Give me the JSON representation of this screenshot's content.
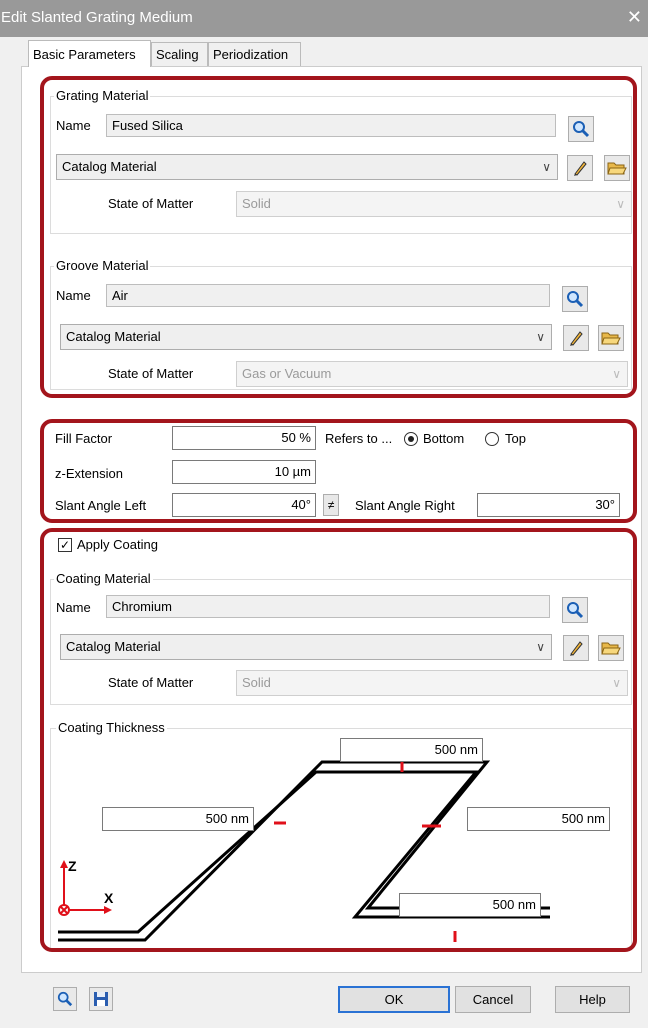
{
  "window": {
    "title": "Edit Slanted Grating Medium",
    "close_glyph": "✕"
  },
  "tabs": [
    {
      "label": "Basic Parameters",
      "active": true
    },
    {
      "label": "Scaling",
      "active": false
    },
    {
      "label": "Periodization",
      "active": false
    }
  ],
  "grating_material": {
    "legend": "Grating Material",
    "name_label": "Name",
    "name_value": "Fused Silica",
    "catalog": "Catalog Material",
    "state_label": "State of Matter",
    "state_value": "Solid"
  },
  "groove_material": {
    "legend": "Groove Material",
    "name_label": "Name",
    "name_value": "Air",
    "catalog": "Catalog Material",
    "state_label": "State of Matter",
    "state_value": "Gas or Vacuum"
  },
  "geometry": {
    "fill_factor_label": "Fill Factor",
    "fill_factor_value": "50 %",
    "refers_to_label": "Refers to ...",
    "option_bottom": "Bottom",
    "option_top": "Top",
    "selected": "Bottom",
    "z_extension_label": "z-Extension",
    "z_extension_value": "10 µm",
    "slant_left_label": "Slant Angle Left",
    "slant_left_value": "40°",
    "neq_button": "≠",
    "slant_right_label": "Slant Angle Right",
    "slant_right_value": "30°"
  },
  "coating": {
    "apply_label": "Apply Coating",
    "apply_checked": true,
    "check_glyph": "✓",
    "legend": "Coating Material",
    "name_label": "Name",
    "name_value": "Chromium",
    "catalog": "Catalog Material",
    "state_label": "State of Matter",
    "state_value": "Solid",
    "thickness_legend": "Coating Thickness",
    "thickness_top": "500 nm",
    "thickness_left": "500 nm",
    "thickness_right": "500 nm",
    "thickness_bottom": "500 nm",
    "axis_z": "Z",
    "axis_x": "X"
  },
  "footer": {
    "ok": "OK",
    "cancel": "Cancel",
    "help": "Help"
  },
  "colors": {
    "highlight_border": "#a3151c",
    "marker": "#e0101a",
    "default_button_border": "#2a72d4"
  },
  "icons": [
    "search-icon",
    "pencil-icon",
    "folder-open-icon",
    "save-icon",
    "dropdown-arrow-icon"
  ]
}
